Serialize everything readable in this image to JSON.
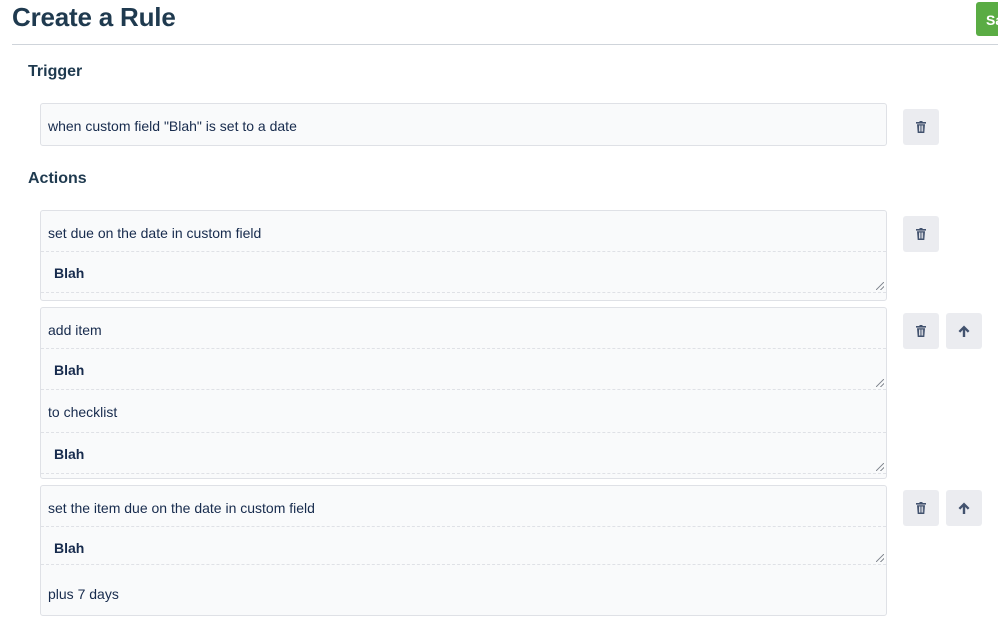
{
  "header": {
    "title": "Create a Rule",
    "save_label": "Sa"
  },
  "trigger": {
    "title": "Trigger",
    "text": "when custom field \"Blah\" is set to a date"
  },
  "actions": {
    "title": "Actions",
    "action1": {
      "text": "set due on the date in custom field",
      "field": "Blah"
    },
    "action2": {
      "text": "add item",
      "item": "Blah",
      "text2": "to checklist",
      "checklist": "Blah"
    },
    "action3": {
      "text": "set the item due on the date in custom field",
      "field": "Blah",
      "text2": "plus 7 days"
    }
  },
  "icons": {
    "delete": "trash-icon",
    "move_up": "arrow-up-icon"
  },
  "colors": {
    "save_button": "#5aac44",
    "title": "#1f3a4f",
    "icon_button_bg": "#ebecf0"
  }
}
